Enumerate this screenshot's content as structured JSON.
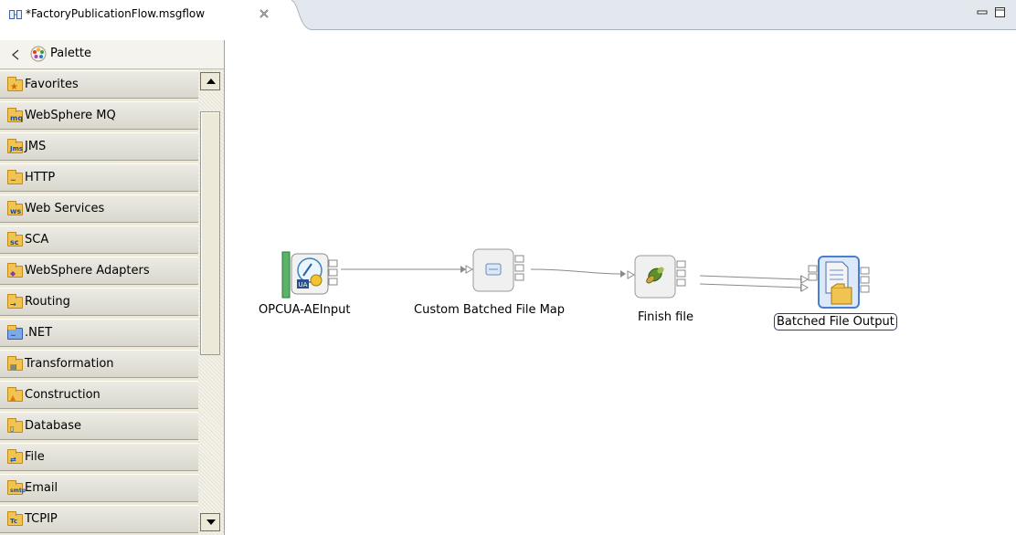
{
  "editor": {
    "tab_title": "*FactoryPublicationFlow.msgflow"
  },
  "palette": {
    "title": "Palette",
    "drawers": [
      {
        "label": "Favorites",
        "icon": "favorites-folder-icon",
        "badge": "★"
      },
      {
        "label": "WebSphere MQ",
        "icon": "mq-folder-icon",
        "badge": "mq"
      },
      {
        "label": "JMS",
        "icon": "jms-folder-icon",
        "badge": "Jms"
      },
      {
        "label": "HTTP",
        "icon": "http-folder-icon",
        "badge": "~"
      },
      {
        "label": "Web Services",
        "icon": "web-services-icon",
        "badge": "ws"
      },
      {
        "label": "SCA",
        "icon": "sca-folder-icon",
        "badge": "sc"
      },
      {
        "label": "WebSphere Adapters",
        "icon": "adapters-folder-icon",
        "badge": "◆"
      },
      {
        "label": "Routing",
        "icon": "routing-folder-icon",
        "badge": "→"
      },
      {
        "label": ".NET",
        "icon": "dotnet-icon",
        "badge": "~"
      },
      {
        "label": "Transformation",
        "icon": "transformation-folder-icon",
        "badge": "▤"
      },
      {
        "label": "Construction",
        "icon": "construction-folder-icon",
        "badge": "▲"
      },
      {
        "label": "Database",
        "icon": "database-folder-icon",
        "badge": "▯"
      },
      {
        "label": "File",
        "icon": "file-folder-icon",
        "badge": "⇄"
      },
      {
        "label": "Email",
        "icon": "email-folder-icon",
        "badge": "smtp"
      },
      {
        "label": "TCPIP",
        "icon": "tcpip-folder-icon",
        "badge": "Tc"
      }
    ]
  },
  "flow": {
    "nodes": [
      {
        "label": "OPCUA-AEInput",
        "icon": "opcua-input-icon",
        "badge": "UA"
      },
      {
        "label": "Custom Batched File Map",
        "icon": "mapping-node-icon"
      },
      {
        "label": "Finish file",
        "icon": "finish-file-node-icon"
      },
      {
        "label": "Batched File Output",
        "icon": "file-output-node-icon"
      }
    ]
  },
  "colors": {
    "tab_bar": "#e3e8ee",
    "palette_bg": "#ece9d8",
    "folder": "#f1c351",
    "selection_border": "#2b3c7e",
    "connection": "#888888"
  }
}
